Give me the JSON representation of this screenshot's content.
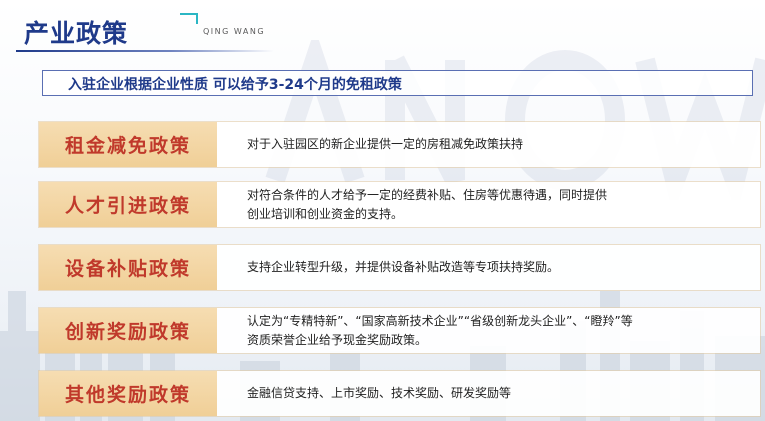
{
  "header": {
    "title": "产业政策",
    "subtitle": "QING WANG"
  },
  "intro": "入驻企业根据企业性质 可以给予3-24个月的免租政策",
  "policies": [
    {
      "label": "租金减免政策",
      "lines": [
        "对于入驻园区的新企业提供一定的房租减免政策扶持"
      ]
    },
    {
      "label": "人才引进政策",
      "lines": [
        "对符合条件的人才给予一定的经费补贴、住房等优惠待遇，同时提供",
        "创业培训和创业资金的支持。"
      ]
    },
    {
      "label": "设备补贴政策",
      "lines": [
        "支持企业转型升级，并提供设备补贴改造等专项扶持奖励。"
      ]
    },
    {
      "label": "创新奖励政策",
      "lines": [
        "认定为“专精特新”、“国家高新技术企业”“省级创新龙头企业”、“瞪羚”等",
        "资质荣誉企业给予现金奖励政策。"
      ]
    },
    {
      "label": "其他奖励政策",
      "lines": [
        "金融信贷支持、上市奖励、技术奖励、研发奖励等"
      ]
    }
  ],
  "colors": {
    "title_blue": "#1f3a8a",
    "label_bg": "#f0cf97",
    "label_text": "#c0392b",
    "accent_teal": "#2bb6c4"
  }
}
